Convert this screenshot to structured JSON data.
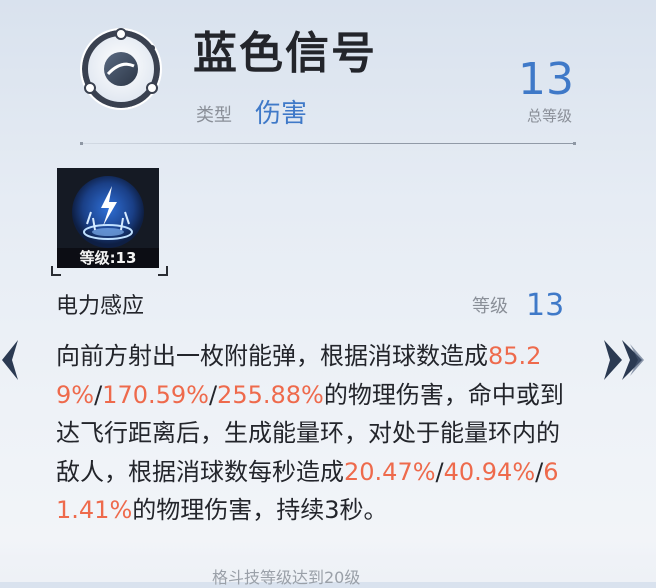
{
  "header": {
    "title": "蓝色信号",
    "type_label": "类型",
    "type_value": "伤害",
    "total_level": "13",
    "total_level_label": "总等级"
  },
  "skill": {
    "icon_level": "等级:13",
    "name": "电力感应",
    "level_label": "等级",
    "level": "13",
    "description": [
      {
        "text": "向前方射出一枚附能弹，根据消球数造成",
        "hl": false
      },
      {
        "text": "85.29%",
        "hl": true
      },
      {
        "text": "/",
        "hl": false
      },
      {
        "text": "170.59%",
        "hl": true
      },
      {
        "text": "/",
        "hl": false
      },
      {
        "text": "255.88%",
        "hl": true
      },
      {
        "text": "的物理伤害，命中或到达飞行距离后，生成能量环，对处于能量环内的敌人，根据消球数每秒造成",
        "hl": false
      },
      {
        "text": "20.47%",
        "hl": true
      },
      {
        "text": "/",
        "hl": false
      },
      {
        "text": "40.94%",
        "hl": true
      },
      {
        "text": "/",
        "hl": false
      },
      {
        "text": "61.41%",
        "hl": true
      },
      {
        "text": "的物理伤害，持续3秒。",
        "hl": false
      }
    ]
  },
  "footer": {
    "hint": "格斗技等级达到20级"
  },
  "icons": {
    "emblem": "ring-orbit-emblem-icon",
    "skill": "lightning-skill-icon",
    "prev": "double-chevron-left-icon",
    "next": "double-chevron-right-icon"
  },
  "colors": {
    "accent_blue": "#3f79c8",
    "highlight_orange": "#ee6a4c"
  }
}
